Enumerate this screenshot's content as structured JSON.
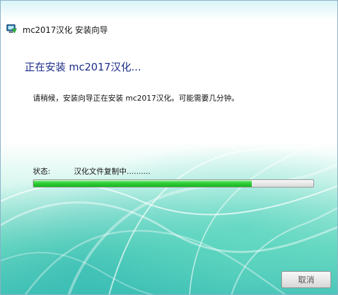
{
  "window": {
    "title": "mc2017汉化 安装向导",
    "icon": "installer-monitor-icon"
  },
  "main": {
    "heading": "正在安装 mc2017汉化...",
    "description": "请稍候，安装向导正在安装 mc2017汉化。可能需要几分钟。",
    "status_label": "状态:",
    "status_text": "汉化文件复制中.........."
  },
  "progress": {
    "value_percent": 78
  },
  "buttons": {
    "cancel": "取消"
  },
  "colors": {
    "heading": "#1b2c89",
    "progress": "#30cf39",
    "background_accent": "#49c5b9"
  }
}
